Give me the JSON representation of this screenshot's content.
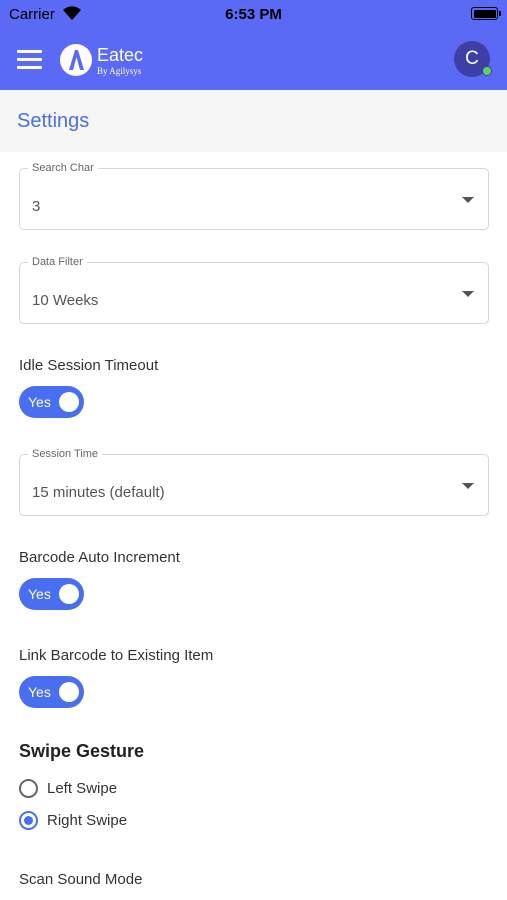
{
  "status_bar": {
    "carrier": "Carrier",
    "time": "6:53 PM"
  },
  "app_bar": {
    "menu_icon": "hamburger-menu-icon",
    "logo": {
      "letter": "A",
      "name": "Eatec",
      "sub": "By Agilysys"
    },
    "avatar_initial": "C",
    "online_color": "#5fd35a",
    "bar_color": "#5b6af5"
  },
  "page": {
    "title": "Settings"
  },
  "settings": {
    "search_char": {
      "label": "Search Char",
      "value": "3"
    },
    "data_filter": {
      "label": "Data Filter",
      "value": "10 Weeks"
    },
    "idle_timeout": {
      "label": "Idle Session Timeout",
      "toggle": "Yes"
    },
    "session_time": {
      "label": "Session Time",
      "value": "15 minutes (default)"
    },
    "barcode_increment": {
      "label": "Barcode Auto Increment",
      "toggle": "Yes"
    },
    "link_barcode": {
      "label": "Link Barcode to Existing Item",
      "toggle": "Yes"
    },
    "swipe_gesture": {
      "title": "Swipe Gesture",
      "options": [
        {
          "label": "Left Swipe",
          "selected": false
        },
        {
          "label": "Right Swipe",
          "selected": true
        }
      ]
    },
    "scan_sound": {
      "label": "Scan Sound Mode"
    }
  },
  "accent_color": "#4a6ef0"
}
